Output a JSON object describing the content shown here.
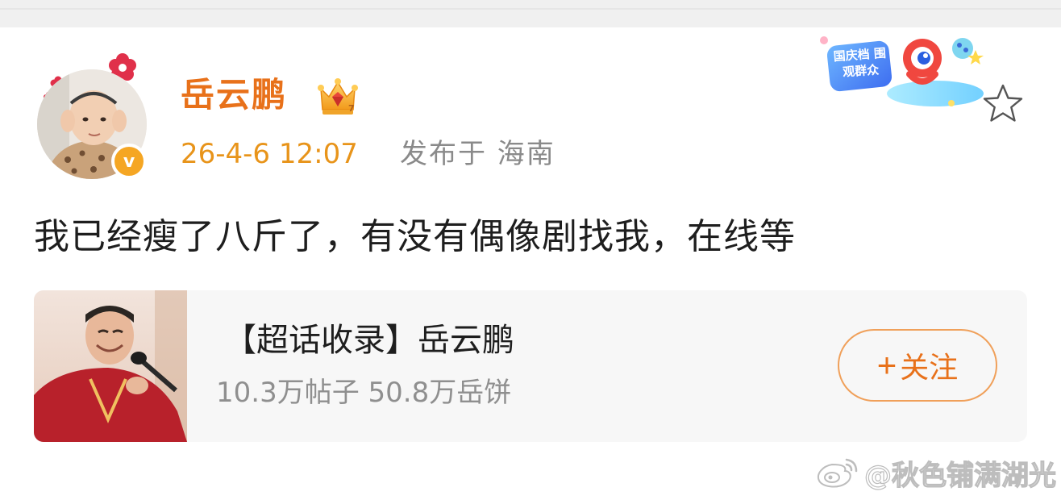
{
  "post": {
    "author": {
      "name": "岳云鹏",
      "verified_mark": "v",
      "avatar": "baby-photo-avatar"
    },
    "time": "26-4-6 12:07",
    "location": "发布于 海南",
    "content": "我已经瘦了八斤了，有没有偶像剧找我，在线等"
  },
  "decoration": {
    "badge_text": "国庆档 围观群众"
  },
  "topic_card": {
    "title": "【超话收录】岳云鹏",
    "stats": "10.3万帖子 50.8万岳饼",
    "follow_plus": "+",
    "follow_label": "关注"
  },
  "watermark": {
    "text": "@秋色铺满湖光"
  },
  "colors": {
    "accent": "#e8711a",
    "time": "#e8941a",
    "muted": "#8a8a8a",
    "card_bg": "#f7f7f7"
  }
}
